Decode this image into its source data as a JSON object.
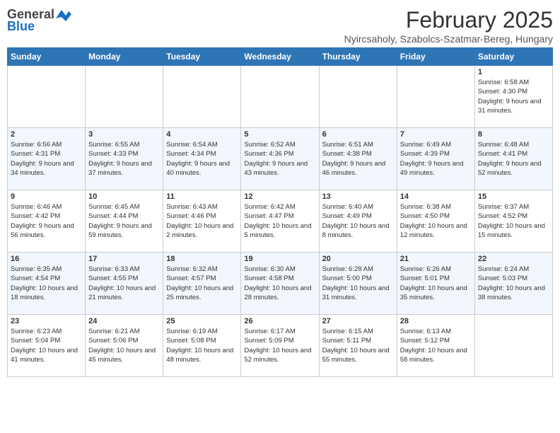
{
  "logo": {
    "general": "General",
    "blue": "Blue"
  },
  "title": "February 2025",
  "subtitle": "Nyircsaholy, Szabolcs-Szatmar-Bereg, Hungary",
  "weekdays": [
    "Sunday",
    "Monday",
    "Tuesday",
    "Wednesday",
    "Thursday",
    "Friday",
    "Saturday"
  ],
  "weeks": [
    [
      {
        "day": "",
        "info": ""
      },
      {
        "day": "",
        "info": ""
      },
      {
        "day": "",
        "info": ""
      },
      {
        "day": "",
        "info": ""
      },
      {
        "day": "",
        "info": ""
      },
      {
        "day": "",
        "info": ""
      },
      {
        "day": "1",
        "info": "Sunrise: 6:58 AM\nSunset: 4:30 PM\nDaylight: 9 hours and 31 minutes."
      }
    ],
    [
      {
        "day": "2",
        "info": "Sunrise: 6:56 AM\nSunset: 4:31 PM\nDaylight: 9 hours and 34 minutes."
      },
      {
        "day": "3",
        "info": "Sunrise: 6:55 AM\nSunset: 4:33 PM\nDaylight: 9 hours and 37 minutes."
      },
      {
        "day": "4",
        "info": "Sunrise: 6:54 AM\nSunset: 4:34 PM\nDaylight: 9 hours and 40 minutes."
      },
      {
        "day": "5",
        "info": "Sunrise: 6:52 AM\nSunset: 4:36 PM\nDaylight: 9 hours and 43 minutes."
      },
      {
        "day": "6",
        "info": "Sunrise: 6:51 AM\nSunset: 4:38 PM\nDaylight: 9 hours and 46 minutes."
      },
      {
        "day": "7",
        "info": "Sunrise: 6:49 AM\nSunset: 4:39 PM\nDaylight: 9 hours and 49 minutes."
      },
      {
        "day": "8",
        "info": "Sunrise: 6:48 AM\nSunset: 4:41 PM\nDaylight: 9 hours and 52 minutes."
      }
    ],
    [
      {
        "day": "9",
        "info": "Sunrise: 6:46 AM\nSunset: 4:42 PM\nDaylight: 9 hours and 56 minutes."
      },
      {
        "day": "10",
        "info": "Sunrise: 6:45 AM\nSunset: 4:44 PM\nDaylight: 9 hours and 59 minutes."
      },
      {
        "day": "11",
        "info": "Sunrise: 6:43 AM\nSunset: 4:46 PM\nDaylight: 10 hours and 2 minutes."
      },
      {
        "day": "12",
        "info": "Sunrise: 6:42 AM\nSunset: 4:47 PM\nDaylight: 10 hours and 5 minutes."
      },
      {
        "day": "13",
        "info": "Sunrise: 6:40 AM\nSunset: 4:49 PM\nDaylight: 10 hours and 8 minutes."
      },
      {
        "day": "14",
        "info": "Sunrise: 6:38 AM\nSunset: 4:50 PM\nDaylight: 10 hours and 12 minutes."
      },
      {
        "day": "15",
        "info": "Sunrise: 6:37 AM\nSunset: 4:52 PM\nDaylight: 10 hours and 15 minutes."
      }
    ],
    [
      {
        "day": "16",
        "info": "Sunrise: 6:35 AM\nSunset: 4:54 PM\nDaylight: 10 hours and 18 minutes."
      },
      {
        "day": "17",
        "info": "Sunrise: 6:33 AM\nSunset: 4:55 PM\nDaylight: 10 hours and 21 minutes."
      },
      {
        "day": "18",
        "info": "Sunrise: 6:32 AM\nSunset: 4:57 PM\nDaylight: 10 hours and 25 minutes."
      },
      {
        "day": "19",
        "info": "Sunrise: 6:30 AM\nSunset: 4:58 PM\nDaylight: 10 hours and 28 minutes."
      },
      {
        "day": "20",
        "info": "Sunrise: 6:28 AM\nSunset: 5:00 PM\nDaylight: 10 hours and 31 minutes."
      },
      {
        "day": "21",
        "info": "Sunrise: 6:26 AM\nSunset: 5:01 PM\nDaylight: 10 hours and 35 minutes."
      },
      {
        "day": "22",
        "info": "Sunrise: 6:24 AM\nSunset: 5:03 PM\nDaylight: 10 hours and 38 minutes."
      }
    ],
    [
      {
        "day": "23",
        "info": "Sunrise: 6:23 AM\nSunset: 5:04 PM\nDaylight: 10 hours and 41 minutes."
      },
      {
        "day": "24",
        "info": "Sunrise: 6:21 AM\nSunset: 5:06 PM\nDaylight: 10 hours and 45 minutes."
      },
      {
        "day": "25",
        "info": "Sunrise: 6:19 AM\nSunset: 5:08 PM\nDaylight: 10 hours and 48 minutes."
      },
      {
        "day": "26",
        "info": "Sunrise: 6:17 AM\nSunset: 5:09 PM\nDaylight: 10 hours and 52 minutes."
      },
      {
        "day": "27",
        "info": "Sunrise: 6:15 AM\nSunset: 5:11 PM\nDaylight: 10 hours and 55 minutes."
      },
      {
        "day": "28",
        "info": "Sunrise: 6:13 AM\nSunset: 5:12 PM\nDaylight: 10 hours and 58 minutes."
      },
      {
        "day": "",
        "info": ""
      }
    ]
  ]
}
